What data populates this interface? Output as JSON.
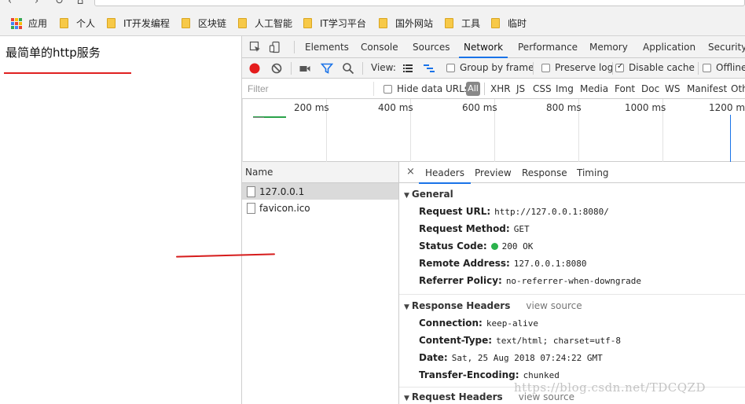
{
  "browser": {
    "bookmarks": [
      {
        "label": "应用",
        "icon": "apps-grid-icon"
      },
      {
        "label": "个人",
        "icon": "folder-icon"
      },
      {
        "label": "IT开发编程",
        "icon": "folder-icon"
      },
      {
        "label": "区块链",
        "icon": "folder-icon"
      },
      {
        "label": "人工智能",
        "icon": "folder-icon"
      },
      {
        "label": "IT学习平台",
        "icon": "folder-icon"
      },
      {
        "label": "国外网站",
        "icon": "folder-icon"
      },
      {
        "label": "工具",
        "icon": "folder-icon"
      },
      {
        "label": "临时",
        "icon": "folder-icon"
      }
    ]
  },
  "page": {
    "heading": "最简单的http服务",
    "underline_color": "#e02020"
  },
  "devtools": {
    "tabs": [
      {
        "label": "Elements",
        "active": false
      },
      {
        "label": "Console",
        "active": false
      },
      {
        "label": "Sources",
        "active": false
      },
      {
        "label": "Network",
        "active": true
      },
      {
        "label": "Performance",
        "active": false
      },
      {
        "label": "Memory",
        "active": false
      },
      {
        "label": "Application",
        "active": false
      },
      {
        "label": "Security",
        "active": false
      }
    ],
    "toolbar": {
      "view_label": "View:",
      "group_by_frame": {
        "label": "Group by frame",
        "checked": false
      },
      "preserve_log": {
        "label": "Preserve log",
        "checked": false
      },
      "disable_cache": {
        "label": "Disable cache",
        "checked": true
      },
      "offline": {
        "label": "Offline",
        "checked": false
      }
    },
    "filter": {
      "placeholder": "Filter",
      "hide_data_urls": {
        "label": "Hide data URLs",
        "checked": false
      },
      "all_label": "All",
      "types": [
        "XHR",
        "JS",
        "CSS",
        "Img",
        "Media",
        "Font",
        "Doc",
        "WS",
        "Manifest",
        "Oth"
      ]
    },
    "timeline": {
      "ticks": [
        "200 ms",
        "400 ms",
        "600 ms",
        "800 ms",
        "1000 ms",
        "1200 ms"
      ]
    },
    "requests": {
      "header": "Name",
      "rows": [
        {
          "name": "127.0.0.1",
          "selected": true
        },
        {
          "name": "favicon.ico",
          "selected": false
        }
      ]
    },
    "detail": {
      "close_symbol": "×",
      "tabs": [
        {
          "label": "Headers",
          "active": true
        },
        {
          "label": "Preview",
          "active": false
        },
        {
          "label": "Response",
          "active": false
        },
        {
          "label": "Timing",
          "active": false
        }
      ],
      "general": {
        "title": "General",
        "rows": [
          {
            "key": "Request URL:",
            "value": "http://127.0.0.1:8080/"
          },
          {
            "key": "Request Method:",
            "value": "GET"
          },
          {
            "key": "Status Code:",
            "value": "200 OK",
            "status_color": "#2bb24c"
          },
          {
            "key": "Remote Address:",
            "value": "127.0.0.1:8080"
          },
          {
            "key": "Referrer Policy:",
            "value": "no-referrer-when-downgrade"
          }
        ]
      },
      "response_headers": {
        "title": "Response Headers",
        "view_source": "view source",
        "rows": [
          {
            "key": "Connection:",
            "value": "keep-alive"
          },
          {
            "key": "Content-Type:",
            "value": "text/html; charset=utf-8"
          },
          {
            "key": "Date:",
            "value": "Sat, 25 Aug 2018 07:24:22 GMT"
          },
          {
            "key": "Transfer-Encoding:",
            "value": "chunked"
          }
        ]
      },
      "request_headers": {
        "title": "Request Headers",
        "view_source": "view source"
      }
    }
  },
  "watermark": "https://blog.csdn.net/TDCQZD",
  "colors": {
    "accent": "#1a73e8",
    "record": "#e41c1c",
    "filter_icon": "#1a73e8",
    "annotation": "#d61c1c"
  }
}
